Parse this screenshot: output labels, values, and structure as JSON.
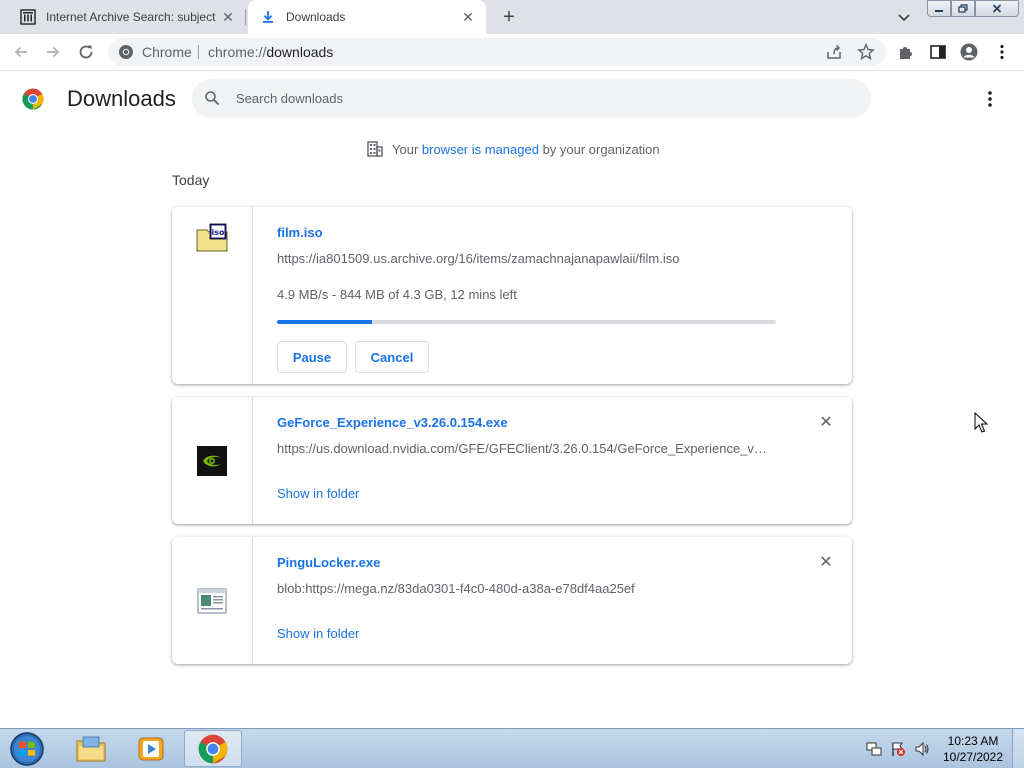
{
  "tabs": [
    {
      "title": "Internet Archive Search: subject:",
      "icon": "archive-icon",
      "close": "✕"
    },
    {
      "title": "Downloads",
      "icon": "download-icon",
      "close": "✕"
    }
  ],
  "new_tab": "+",
  "omnibox": {
    "site_label": "Chrome",
    "url_scheme": "chrome://",
    "url_path": "downloads"
  },
  "page": {
    "title": "Downloads",
    "search_placeholder": "Search downloads",
    "managed_prefix": "Your ",
    "managed_link": "browser is managed",
    "managed_suffix": " by your organization",
    "section": "Today"
  },
  "downloads": [
    {
      "name": "film.iso",
      "url": "https://ia801509.us.archive.org/16/items/zamachnajanapawlaii/film.iso",
      "status": "4.9 MB/s - 844 MB of 4.3 GB, 12 mins left",
      "progress": 0.19,
      "pause_label": "Pause",
      "cancel_label": "Cancel",
      "icon": "iso-file-icon"
    },
    {
      "name": "GeForce_Experience_v3.26.0.154.exe",
      "url": "https://us.download.nvidia.com/GFE/GFEClient/3.26.0.154/GeForce_Experience_v3....",
      "action": "Show in folder",
      "icon": "nvidia-icon",
      "remove": "✕"
    },
    {
      "name": "PinguLocker.exe",
      "url": "blob:https://mega.nz/83da0301-f4c0-480d-a38a-e78df4aa25ef",
      "action": "Show in folder",
      "icon": "exe-file-icon",
      "remove": "✕"
    }
  ],
  "taskbar": {
    "time": "10:23 AM",
    "date": "10/27/2022",
    "apps": [
      "explorer-icon",
      "media-player-icon",
      "chrome-icon"
    ]
  },
  "colors": {
    "accent": "#1a73e8",
    "tab_strip": "#dee1e6",
    "taskbar": "#b4cbe3"
  }
}
